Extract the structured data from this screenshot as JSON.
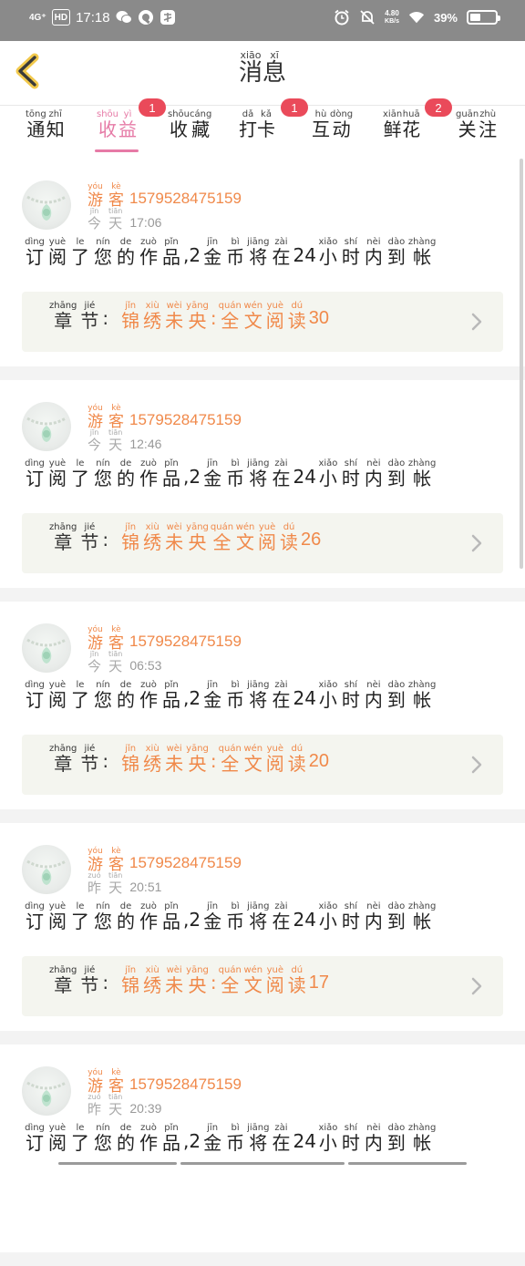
{
  "status_bar": {
    "network": "4G⁺",
    "hd": "HD",
    "time": "17:18",
    "speed_value": "4.80",
    "speed_unit": "KB/s",
    "battery": "39%",
    "battery_level": 0.39,
    "icons": [
      "signal-icon",
      "hd-icon",
      "wechat-icon",
      "q-app-icon",
      "security-app-icon",
      "alarm-icon",
      "mute-icon",
      "wifi-icon",
      "battery-icon"
    ]
  },
  "header": {
    "title": [
      {
        "hz": "消",
        "py": "xiāo"
      },
      {
        "hz": "息",
        "py": "xī"
      }
    ],
    "back_icon": "chevron-left-icon"
  },
  "tabs": [
    {
      "key": "notice",
      "chars": [
        {
          "hz": "通",
          "py": "tōng"
        },
        {
          "hz": "知",
          "py": "zhī"
        }
      ]
    },
    {
      "key": "income",
      "active": true,
      "badge": "1",
      "chars": [
        {
          "hz": "收",
          "py": "shōu"
        },
        {
          "hz": "益",
          "py": "yì"
        }
      ]
    },
    {
      "key": "collect",
      "chars": [
        {
          "hz": "收",
          "py": "shōu"
        },
        {
          "hz": "藏",
          "py": "cáng"
        }
      ]
    },
    {
      "key": "checkin",
      "badge": "1",
      "chars": [
        {
          "hz": "打",
          "py": "dǎ"
        },
        {
          "hz": "卡",
          "py": "kǎ"
        }
      ]
    },
    {
      "key": "interact",
      "chars": [
        {
          "hz": "互",
          "py": "hù"
        },
        {
          "hz": "动",
          "py": "dòng"
        }
      ]
    },
    {
      "key": "flowers",
      "badge": "2",
      "chars": [
        {
          "hz": "鲜",
          "py": "xiān"
        },
        {
          "hz": "花",
          "py": "huā"
        }
      ]
    },
    {
      "key": "follow",
      "chars": [
        {
          "hz": "关",
          "py": "guān"
        },
        {
          "hz": "注",
          "py": "zhù"
        }
      ]
    }
  ],
  "labels": {
    "guest": [
      {
        "hz": "游",
        "py": "yóu"
      },
      {
        "hz": "客",
        "py": "kè"
      }
    ],
    "today": [
      {
        "hz": "今",
        "py": "jīn"
      },
      {
        "hz": "天",
        "py": "tiān"
      }
    ],
    "yesterday": [
      {
        "hz": "昨",
        "py": "zuó"
      },
      {
        "hz": "天",
        "py": "tiān"
      }
    ],
    "chapter": [
      {
        "hz": "章",
        "py": "zhāng"
      },
      {
        "hz": "节",
        "py": "jié"
      }
    ],
    "chapter_colon": ":",
    "book": [
      {
        "hz": "锦",
        "py": "jǐn"
      },
      {
        "hz": "绣",
        "py": "xiù"
      },
      {
        "hz": "未",
        "py": "wèi"
      },
      {
        "hz": "央",
        "py": "yāng"
      }
    ],
    "book_rest": [
      {
        "hz": "全",
        "py": "quán"
      },
      {
        "hz": "文",
        "py": "wén"
      },
      {
        "hz": "阅",
        "py": "yuè"
      },
      {
        "hz": "读",
        "py": "dú"
      }
    ],
    "book_sep": ":",
    "message_part1": [
      {
        "hz": "订",
        "py": "dìng"
      },
      {
        "hz": "阅",
        "py": "yuè"
      },
      {
        "hz": "了",
        "py": "le"
      },
      {
        "hz": "您",
        "py": "nín"
      },
      {
        "hz": "的",
        "py": "de"
      },
      {
        "hz": "作",
        "py": "zuò"
      },
      {
        "hz": "品",
        "py": "pǐn"
      }
    ],
    "message_amount": ",2",
    "message_part2": [
      {
        "hz": "金",
        "py": "jīn"
      },
      {
        "hz": "币",
        "py": "bì"
      },
      {
        "hz": "将",
        "py": "jiāng"
      },
      {
        "hz": "在",
        "py": "zài"
      }
    ],
    "message_hours": "24",
    "message_part3": [
      {
        "hz": "小",
        "py": "xiǎo"
      },
      {
        "hz": "时",
        "py": "shí"
      },
      {
        "hz": "内",
        "py": "nèi"
      },
      {
        "hz": "到",
        "py": "dào"
      },
      {
        "hz": "帐",
        "py": "zhàng"
      }
    ]
  },
  "messages": [
    {
      "user": "15795284 75159",
      "day": "today",
      "time": "17:06",
      "chapter_num": "30",
      "sep": true
    },
    {
      "user": "15795284 75159",
      "day": "today",
      "time": "12:46",
      "chapter_num": "26",
      "sep": false
    },
    {
      "user": "15795284 75159",
      "day": "today",
      "time": "06:53",
      "chapter_num": "20",
      "sep": true
    },
    {
      "user": "15795284 75159",
      "day": "yesterday",
      "time": "20:51",
      "chapter_num": "17",
      "sep": true
    },
    {
      "user": "15795284 75159",
      "day": "yesterday",
      "time": "20:39",
      "chapter_num": "",
      "sep": true
    }
  ]
}
